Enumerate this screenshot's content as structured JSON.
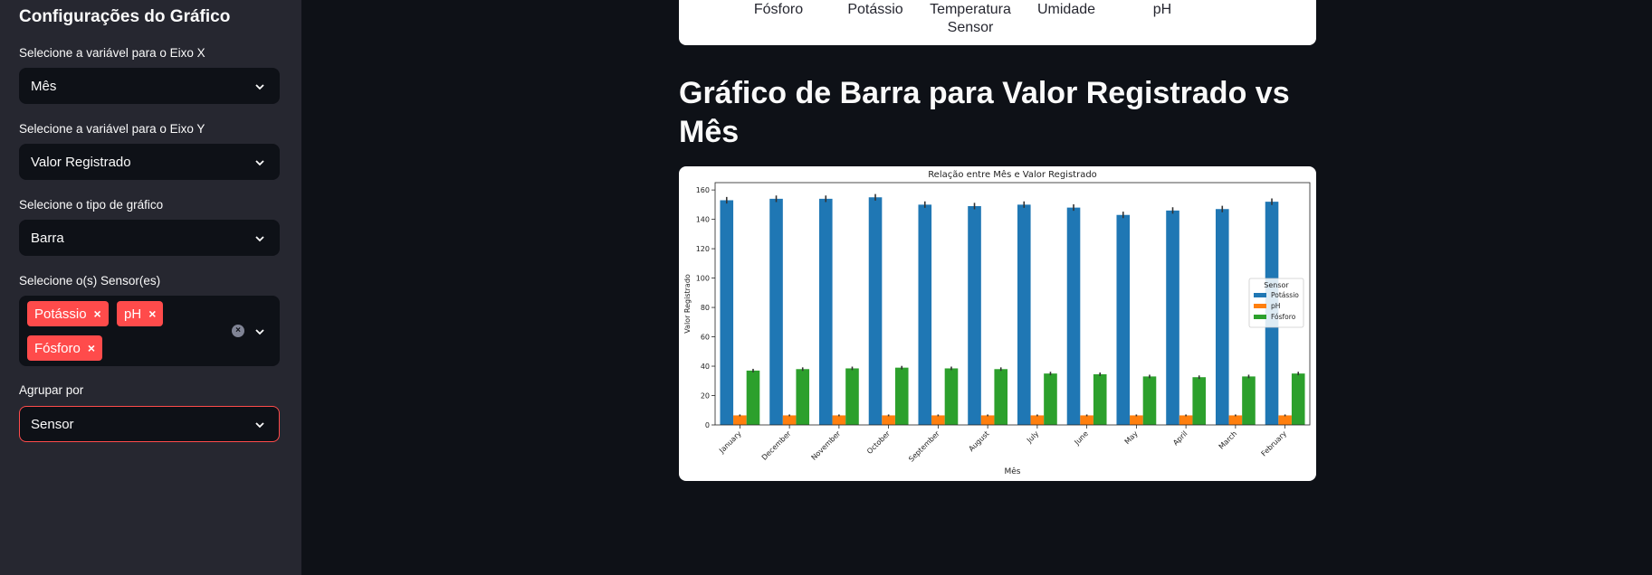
{
  "sidebar": {
    "title": "Configurações do Gráfico",
    "x_axis": {
      "label": "Selecione a variável para o Eixo X",
      "value": "Mês"
    },
    "y_axis": {
      "label": "Selecione a variável para o Eixo Y",
      "value": "Valor Registrado"
    },
    "chart_type": {
      "label": "Selecione o tipo de gráfico",
      "value": "Barra"
    },
    "sensors": {
      "label": "Selecione o(s) Sensor(es)",
      "chips": [
        "Potássio",
        "pH",
        "Fósforo"
      ],
      "remove_glyph": "×",
      "clear_glyph": "×"
    },
    "group_by": {
      "label": "Agrupar por",
      "value": "Sensor"
    }
  },
  "table": {
    "headers": [
      "Fósforo",
      "Potássio",
      "Temperatura Sensor",
      "Umidade",
      "pH"
    ]
  },
  "main": {
    "heading": "Gráfico de Barra para Valor Registrado vs Mês"
  },
  "colors": {
    "accent": "#ff4b4b",
    "potassio": "#1f77b4",
    "ph": "#ff7f0e",
    "fosforo": "#2ca02c"
  },
  "chart_data": {
    "type": "bar",
    "title": "Relação entre Mês e Valor Registrado",
    "xlabel": "Mês",
    "ylabel": "Valor Registrado",
    "ylim": [
      0,
      165
    ],
    "yticks": [
      0,
      20,
      40,
      60,
      80,
      100,
      120,
      140,
      160
    ],
    "categories": [
      "January",
      "December",
      "November",
      "October",
      "September",
      "August",
      "July",
      "June",
      "May",
      "April",
      "March",
      "February"
    ],
    "series": [
      {
        "name": "Potássio",
        "values": [
          153,
          154,
          154,
          155,
          150,
          149,
          150,
          148,
          143,
          146,
          147,
          152
        ]
      },
      {
        "name": "pH",
        "values": [
          6.5,
          6.5,
          6.5,
          6.5,
          6.5,
          6.5,
          6.5,
          6.5,
          6.5,
          6.5,
          6.5,
          6.5
        ]
      },
      {
        "name": "Fósforo",
        "values": [
          37,
          38,
          38.5,
          39,
          38.5,
          38,
          35,
          34.5,
          33,
          32.5,
          33,
          35
        ]
      }
    ],
    "legend_title": "Sensor",
    "legend_position": "right",
    "error_bars": true
  }
}
